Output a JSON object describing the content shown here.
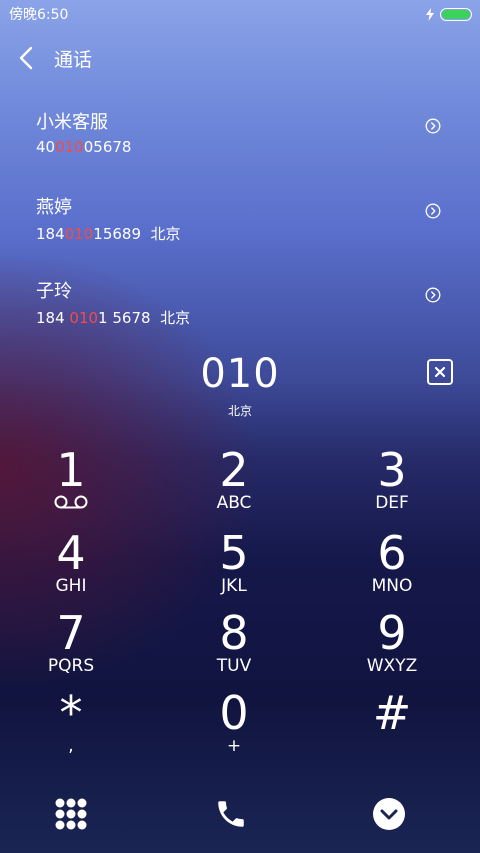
{
  "status_bar": {
    "time": "傍晚6:50",
    "battery_level": 1.0,
    "battery_color": "#3bd35a"
  },
  "header": {
    "title": "通话",
    "back_icon": "chevron-left-icon"
  },
  "contacts": [
    {
      "name": "小米客服",
      "number_before": "40",
      "number_match": "010",
      "number_after": "05678",
      "location": ""
    },
    {
      "name": "燕婷",
      "number_before": "184",
      "number_match": "010",
      "number_after": "15689",
      "location": "北京"
    },
    {
      "name": "子玲",
      "number_before": "184 ",
      "number_match": "010",
      "number_after": "1 5678",
      "location": "北京"
    }
  ],
  "match_color": "#f24b4b",
  "dialer": {
    "number": "010",
    "location": "北京"
  },
  "keypad": [
    {
      "digit": "1",
      "letters": "",
      "icon": "voicemail-icon"
    },
    {
      "digit": "2",
      "letters": "ABC"
    },
    {
      "digit": "3",
      "letters": "DEF"
    },
    {
      "digit": "4",
      "letters": "GHI"
    },
    {
      "digit": "5",
      "letters": "JKL"
    },
    {
      "digit": "6",
      "letters": "MNO"
    },
    {
      "digit": "7",
      "letters": "PQRS"
    },
    {
      "digit": "8",
      "letters": "TUV"
    },
    {
      "digit": "9",
      "letters": "WXYZ"
    },
    {
      "digit": "*",
      "letters": ","
    },
    {
      "digit": "0",
      "letters": "+"
    },
    {
      "digit": "#",
      "letters": ""
    }
  ],
  "bottom_bar": {
    "left_icon": "grid-icon",
    "center_icon": "phone-icon",
    "right_icon": "chevron-down-circle-icon"
  }
}
